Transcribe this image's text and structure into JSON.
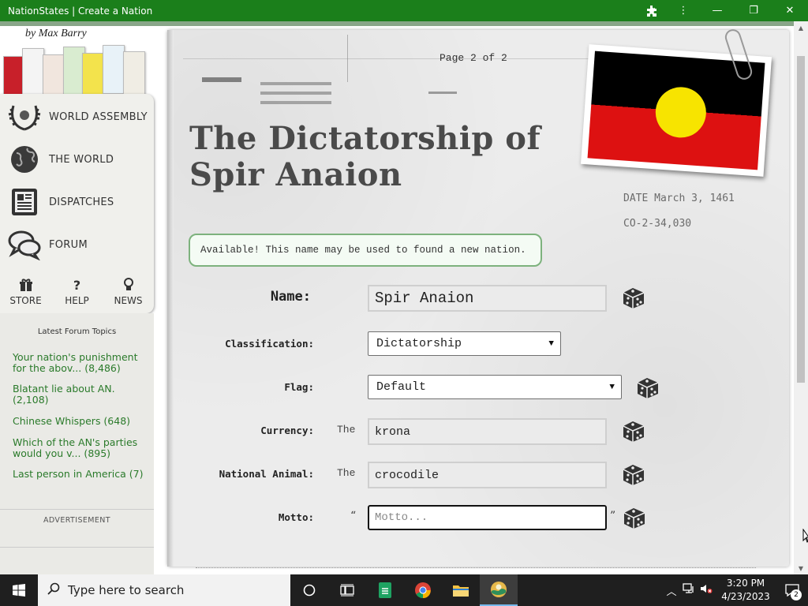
{
  "window": {
    "title": "NationStates | Create a Nation",
    "minimize": "—",
    "restore": "❐",
    "close": "✕"
  },
  "sidebar": {
    "byline": "by Max Barry",
    "nav": [
      {
        "label": "WORLD ASSEMBLY",
        "icon": "laurel-icon"
      },
      {
        "label": "THE WORLD",
        "icon": "globe-icon"
      },
      {
        "label": "DISPATCHES",
        "icon": "newspaper-icon"
      },
      {
        "label": "FORUM",
        "icon": "speech-bubbles-icon"
      }
    ],
    "mini": [
      {
        "label": "STORE",
        "glyph": "🎁"
      },
      {
        "label": "HELP",
        "glyph": "?"
      },
      {
        "label": "NEWS",
        "glyph": "💡"
      }
    ],
    "forum_heading": "Latest Forum Topics",
    "forum_topics": [
      "Your nation's punishment for the abov... (8,486)",
      "Blatant lie about AN. (2,108)",
      "Chinese Whispers (648)",
      "Which of the AN's parties would you v... (895)",
      "Last person in America (7)"
    ],
    "ad_label": "ADVERTISEMENT"
  },
  "main": {
    "page_indicator": "Page 2 of 2",
    "nation_title_line1": "The Dictatorship of",
    "nation_title_line2": "Spir Anaion",
    "stamp_date": "DATE  March 3, 1461",
    "stamp_code": "CO-2-34,030",
    "availability": "Available! This name may be used to found a new nation.",
    "form": {
      "name_label": "Name:",
      "name_value": "Spir Anaion",
      "classification_label": "Classification:",
      "classification_value": "Dictatorship",
      "flag_label": "Flag:",
      "flag_value": "Default",
      "currency_label": "Currency:",
      "currency_prefix": "The",
      "currency_value": "krona",
      "animal_label": "National Animal:",
      "animal_prefix": "The",
      "animal_value": "crocodile",
      "motto_label": "Motto:",
      "motto_open_quote": "“",
      "motto_close_quote": "”",
      "motto_placeholder": "Motto..."
    },
    "flag_colors": {
      "top": "#000000",
      "bottom": "#dd1111",
      "sun": "#f7e400"
    }
  },
  "taskbar": {
    "search_placeholder": "Type here to search",
    "time": "3:20 PM",
    "date": "4/23/2023",
    "notification_count": "2"
  },
  "colors": {
    "titlebar": "#1b7f1b",
    "link": "#2a7a2a",
    "accent_border": "#7db27d"
  }
}
